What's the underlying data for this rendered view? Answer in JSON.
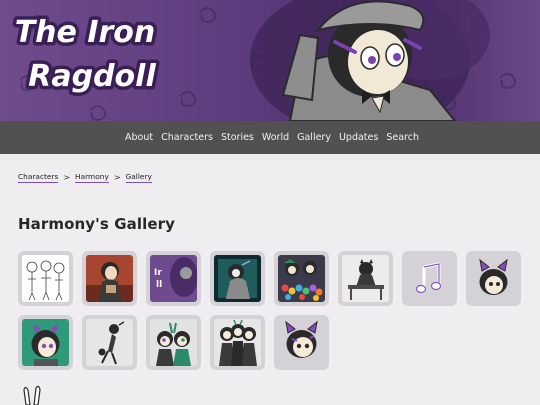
{
  "site": {
    "logo_line1": "The Iron",
    "logo_line2": "Ragdoll"
  },
  "nav": {
    "items": [
      "About",
      "Characters",
      "Stories",
      "World",
      "Gallery",
      "Updates",
      "Search"
    ]
  },
  "breadcrumb": {
    "items": [
      "Characters",
      "Harmony",
      "Gallery"
    ],
    "separator": ">"
  },
  "page": {
    "title": "Harmony's Gallery"
  },
  "gallery": {
    "items": [
      {
        "icon": "sketch-lineup-thumbnail"
      },
      {
        "icon": "warm-character-thumbnail"
      },
      {
        "icon": "purple-banner-thumbnail"
      },
      {
        "icon": "dark-teal-scene-thumbnail"
      },
      {
        "icon": "colorful-bubbles-thumbnail"
      },
      {
        "icon": "desk-scene-thumbnail"
      },
      {
        "icon": "music-note-icon-thumbnail"
      },
      {
        "icon": "cat-ear-face-thumbnail"
      },
      {
        "icon": "teal-portrait-thumbnail"
      },
      {
        "icon": "black-white-figure-thumbnail"
      },
      {
        "icon": "duo-teal-thumbnail"
      },
      {
        "icon": "group-dark-thumbnail"
      },
      {
        "icon": "purple-ears-face-thumbnail"
      }
    ]
  },
  "colors": {
    "accent": "#7b4fb5",
    "nav_bg": "#515151",
    "banner_purple": "#5d3c7d",
    "thumb_bg": "#d4d2d6",
    "page_bg": "#efedf0"
  }
}
